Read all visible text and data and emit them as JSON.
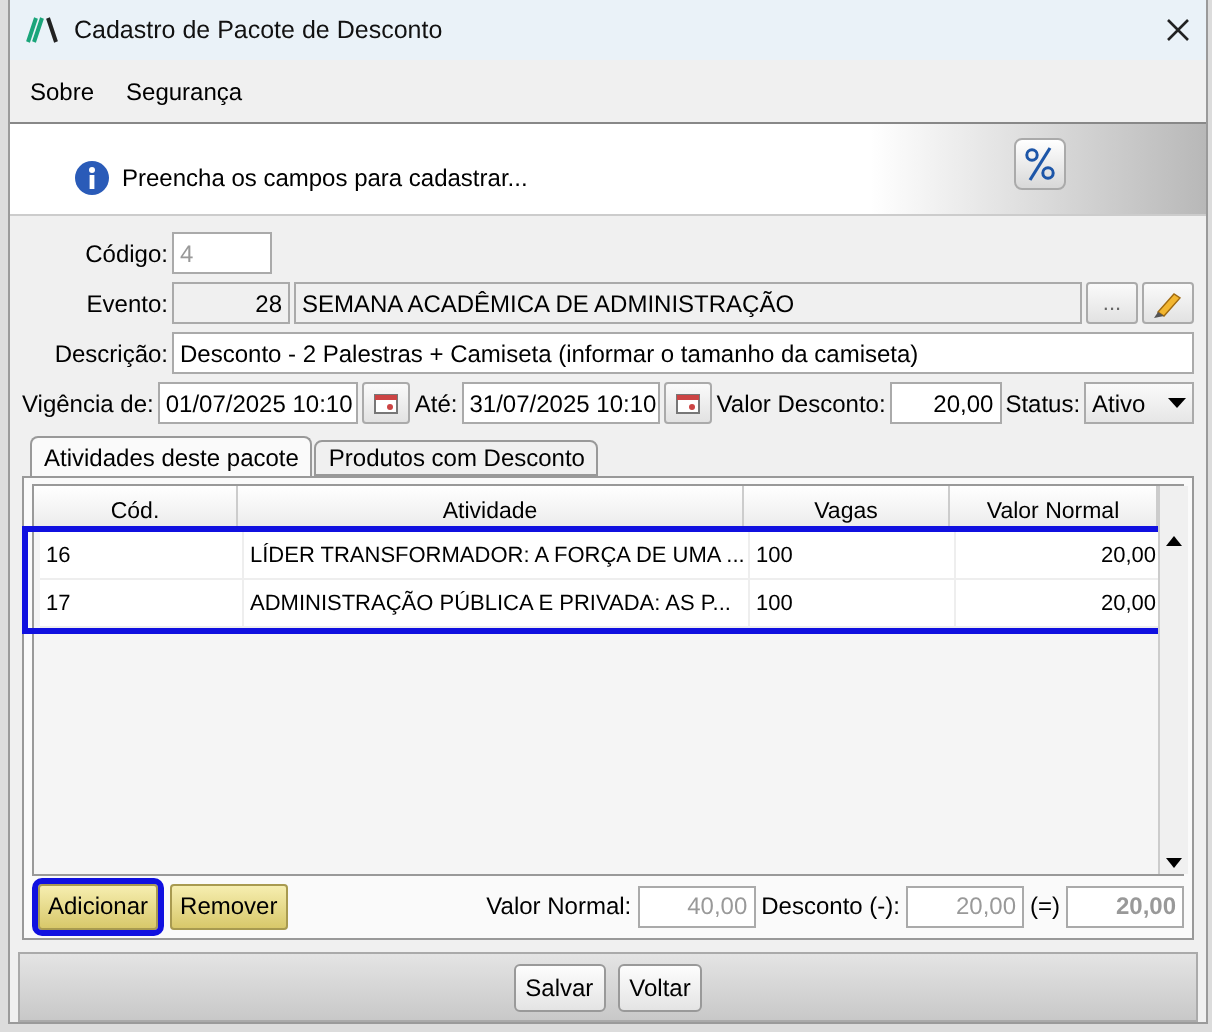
{
  "window": {
    "title": "Cadastro de Pacote de Desconto"
  },
  "menu": [
    "Sobre",
    "Segurança"
  ],
  "header": {
    "message": "Preencha os campos para cadastrar..."
  },
  "form": {
    "codigo_label": "Código:",
    "codigo": "4",
    "evento_label": "Evento:",
    "evento_id": "28",
    "evento_nome": "SEMANA ACADÊMICA DE ADMINISTRAÇÃO",
    "lookup_button": "...",
    "descricao_label": "Descrição:",
    "descricao": "Desconto - 2 Palestras + Camiseta (informar o tamanho da camiseta)",
    "vigencia_label": "Vigência de:",
    "vigencia_de": "01/07/2025 10:10",
    "ate_label": "Até:",
    "ate": "31/07/2025 10:10",
    "valor_label": "Valor Desconto:",
    "valor": "20,00",
    "status_label": "Status:",
    "status": "Ativo"
  },
  "tabs": [
    {
      "label": "Atividades deste pacote",
      "selected": true
    },
    {
      "label": "Produtos com Desconto",
      "selected": false
    }
  ],
  "table": {
    "highlighted": true,
    "columns": [
      "Cód.",
      "Atividade",
      "Vagas",
      "Valor Normal"
    ],
    "rows": [
      [
        "16",
        "LÍDER TRANSFORMADOR: A FORÇA DE UMA ...",
        "100",
        "20,00"
      ],
      [
        "17",
        "ADMINISTRAÇÃO PÚBLICA E PRIVADA: AS P...",
        "100",
        "20,00"
      ]
    ]
  },
  "actions": [
    {
      "label": "Adicionar",
      "highlighted": true
    },
    {
      "label": "Remover",
      "highlighted": false
    }
  ],
  "totals": {
    "normal_label": "Valor Normal:",
    "normal": "40,00",
    "desconto_label": "Desconto (-):",
    "desconto": "20,00",
    "igual_label": "(=)",
    "total": "20,00"
  },
  "footer": [
    "Salvar",
    "Voltar"
  ]
}
